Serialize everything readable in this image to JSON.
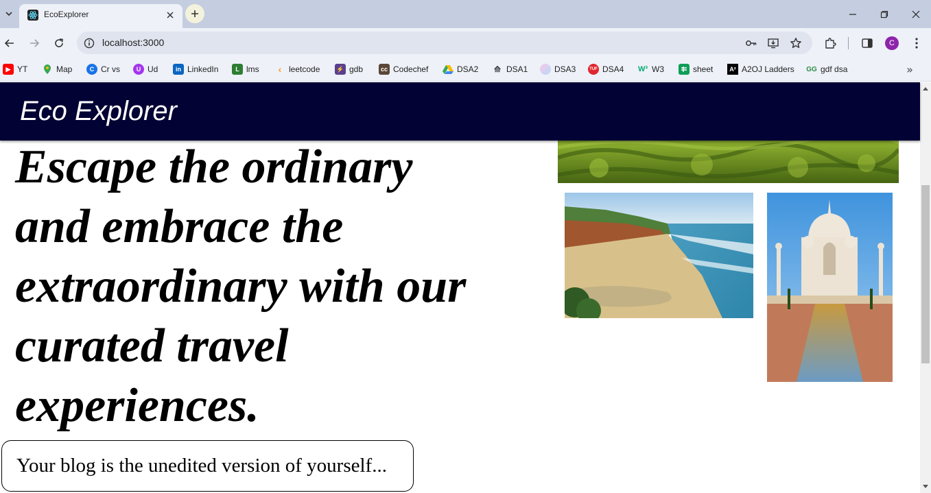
{
  "browser": {
    "tab": {
      "title": "EcoExplorer",
      "favicon": "react-icon"
    },
    "url": "localhost:3000",
    "bookmarks": [
      {
        "label": "YT",
        "icon": "youtube-icon",
        "color": "#ff0000"
      },
      {
        "label": "Map",
        "icon": "maps-pin-icon",
        "color": "#34a853"
      },
      {
        "label": "Cr vs",
        "icon": "c-icon",
        "color": "#1a73e8"
      },
      {
        "label": "Ud",
        "icon": "udemy-icon",
        "color": "#a435f0"
      },
      {
        "label": "LinkedIn",
        "icon": "linkedin-icon",
        "color": "#0a66c2"
      },
      {
        "label": "lms",
        "icon": "lms-icon",
        "color": "#2e7d32"
      },
      {
        "label": "leetcode",
        "icon": "leetcode-icon",
        "color": "#f89f1b"
      },
      {
        "label": "gdb",
        "icon": "lightning-icon",
        "color": "#5b3f8f"
      },
      {
        "label": "Codechef",
        "icon": "codechef-icon",
        "color": "#5b4638"
      },
      {
        "label": "DSA2",
        "icon": "drive-icon",
        "color": "#fbbc04"
      },
      {
        "label": "DSA1",
        "icon": "rocket-icon",
        "color": "#3c4043"
      },
      {
        "label": "DSA3",
        "icon": "gradient-circle-icon",
        "color": "#c7b3f5"
      },
      {
        "label": "DSA4",
        "icon": "tuf-icon",
        "color": "#e0262e"
      },
      {
        "label": "W3",
        "icon": "w3-icon",
        "color": "#04aa6d"
      },
      {
        "label": "sheet",
        "icon": "sheets-icon",
        "color": "#0f9d58"
      },
      {
        "label": "A2OJ Ladders",
        "icon": "a2oj-icon",
        "color": "#000000"
      },
      {
        "label": "gdf dsa",
        "icon": "gfg-icon",
        "color": "#2f8d46"
      }
    ],
    "profile_initial": "C"
  },
  "site": {
    "logo": "Eco Explorer",
    "header_color": "#020234",
    "hero_text": "Escape the ordinary and embrace the extraordinary with our curated travel experiences.",
    "quote": "Your blog is the unedited version of yourself..."
  }
}
